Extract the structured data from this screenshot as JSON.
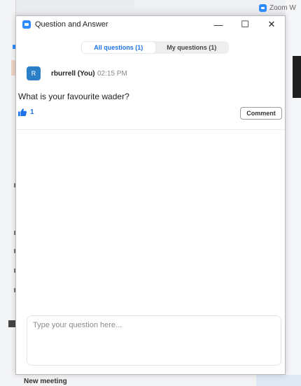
{
  "background": {
    "zoom_tab_label": "Zoom W",
    "bottom_label": "New meeting"
  },
  "window": {
    "title": "Question and Answer",
    "controls": {
      "minimize": "—",
      "maximize": "☐",
      "close": "✕"
    }
  },
  "tabs": [
    {
      "label": "All questions (1)",
      "active": true
    },
    {
      "label": "My questions (1)",
      "active": false
    }
  ],
  "question": {
    "avatar_initial": "R",
    "author": "rburrell (You)",
    "time": "02:15 PM",
    "text": "What is your favourite wader?",
    "like_count": "1",
    "comment_label": "Comment"
  },
  "input": {
    "placeholder": "Type your question here..."
  },
  "colors": {
    "accent": "#1a73e8",
    "avatar": "#2a7fc7",
    "app_icon": "#2d8cff"
  }
}
